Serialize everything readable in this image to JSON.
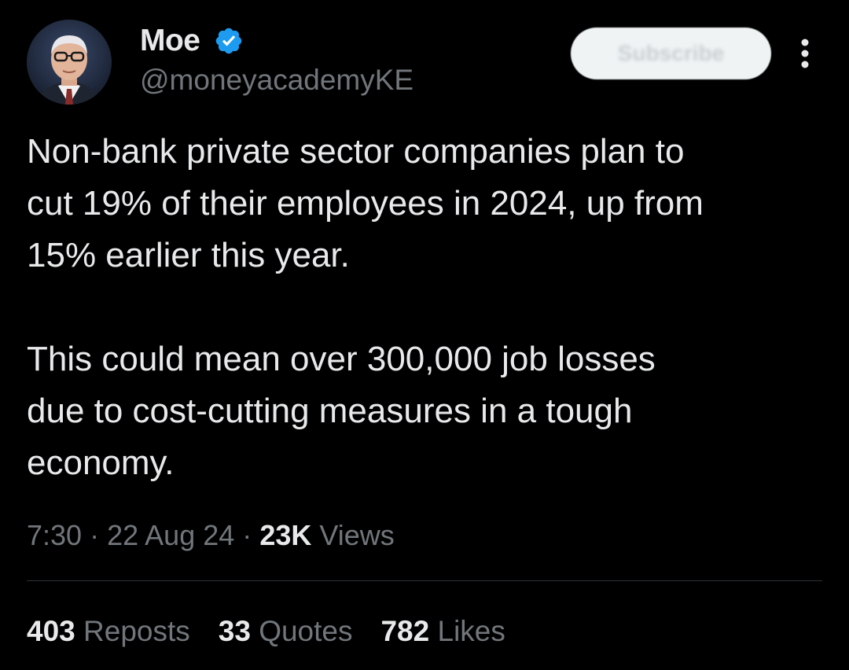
{
  "author": {
    "name": "Moe",
    "handle": "@moneyacademyKE",
    "verified": true,
    "avatar_icon": "profile-photo-avatar"
  },
  "header": {
    "subscribe_label": "Subscribe",
    "more_icon": "more-vertical-icon"
  },
  "tweet": {
    "paragraphs": [
      "Non-bank private sector companies plan to\ncut 19% of their employees in 2024, up from\n15% earlier this year.",
      "This could mean over 300,000 job losses\ndue to cost-cutting measures in a tough\neconomy."
    ]
  },
  "meta": {
    "time": "7:30",
    "separator": "·",
    "date": "22 Aug 24",
    "views_count": "23K",
    "views_label": "Views"
  },
  "stats": {
    "reposts_count": "403",
    "reposts_label": "Reposts",
    "quotes_count": "33",
    "quotes_label": "Quotes",
    "likes_count": "782",
    "likes_label": "Likes"
  },
  "colors": {
    "background": "#000000",
    "text_primary": "#e7e9ea",
    "text_secondary": "#71767b",
    "verified_blue": "#1d9bf0",
    "divider": "#2f3336"
  }
}
